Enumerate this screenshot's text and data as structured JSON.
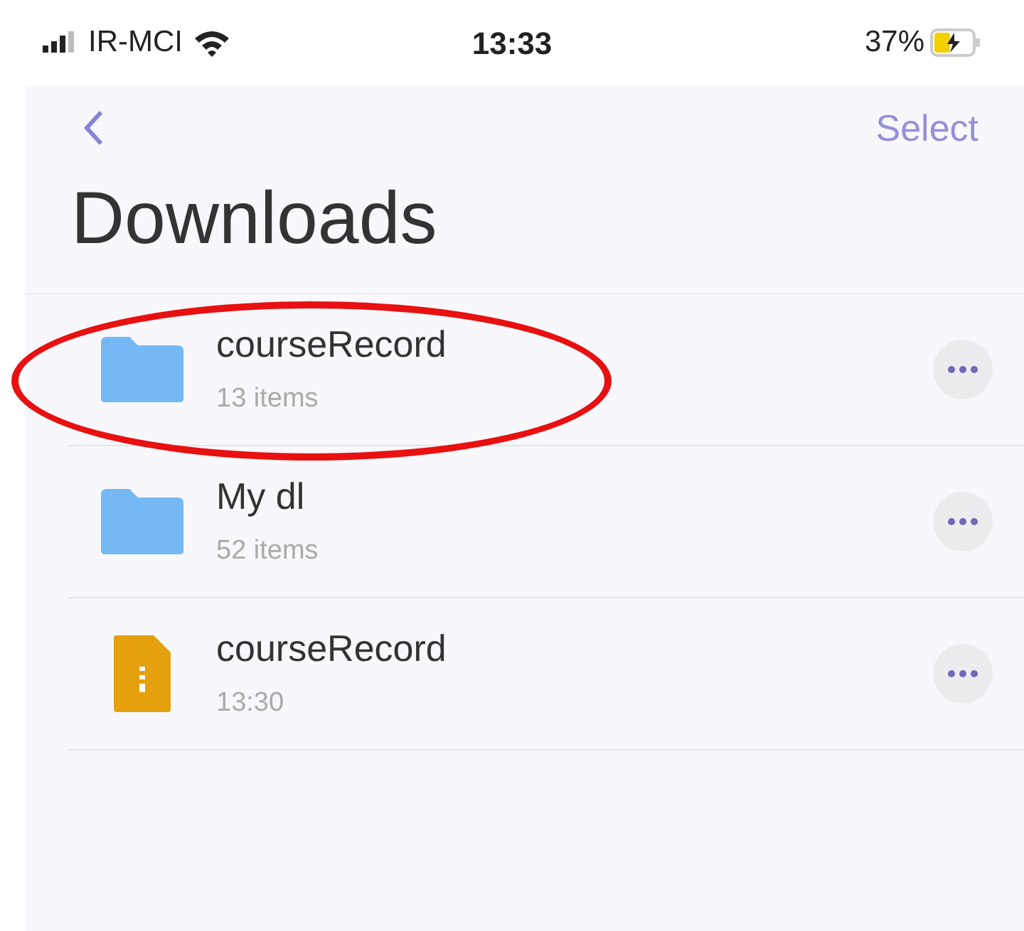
{
  "status_bar": {
    "carrier": "IR-MCI",
    "time": "13:33",
    "battery": "37%"
  },
  "nav": {
    "select": "Select"
  },
  "title": "Downloads",
  "items": [
    {
      "kind": "folder",
      "name": "courseRecord",
      "detail": "13 items",
      "annotated": true
    },
    {
      "kind": "folder",
      "name": "My dl",
      "detail": "52 items",
      "annotated": false
    },
    {
      "kind": "zip",
      "name": "courseRecord",
      "detail": "13:30",
      "annotated": false
    }
  ]
}
